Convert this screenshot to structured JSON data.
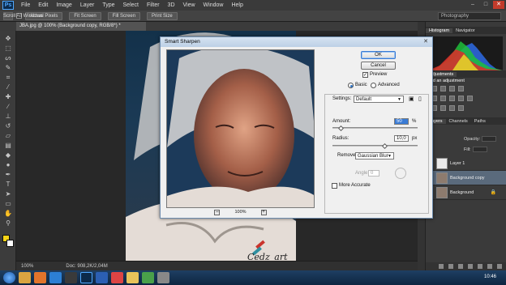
{
  "menubar": {
    "logo": "Ps",
    "items": [
      "File",
      "Edit",
      "Image",
      "Layer",
      "Type",
      "Select",
      "Filter",
      "3D",
      "View",
      "Window",
      "Help"
    ],
    "window_controls": [
      "–",
      "□",
      "✕"
    ]
  },
  "optionsbar": {
    "scroll_all_label": "Scroll All Windows",
    "buttons": [
      "Actual Pixels",
      "Fit Screen",
      "Fill Screen",
      "Print Size"
    ],
    "workspace": "Photography"
  },
  "document": {
    "tab_title": "JBA.jpg @ 100% (Background copy, RGB/8*) *",
    "zoom": "100%",
    "doc_size": "Doc: 908,2K/2,04M"
  },
  "dialog": {
    "title": "Smart Sharpen",
    "close": "✕",
    "ok_label": "OK",
    "cancel_label": "Cancel",
    "preview_label": "Preview",
    "preview_checked": true,
    "mode_basic": "Basic",
    "mode_advanced": "Advanced",
    "mode_selected": "Basic",
    "settings_label": "Settings:",
    "settings_value": "Default",
    "amount_label": "Amount:",
    "amount_value": "50",
    "amount_unit": "%",
    "amount_fraction": 0.1,
    "radius_label": "Radius:",
    "radius_value": "10,0",
    "radius_unit": "px",
    "radius_fraction": 0.62,
    "remove_label": "Remove:",
    "remove_value": "Gaussian Blur",
    "angle_label": "Angle:",
    "angle_value": "0",
    "more_accurate_label": "More Accurate",
    "more_accurate_checked": false,
    "preview_zoom": "100%",
    "zoom_out": "–",
    "zoom_in": "+"
  },
  "panels": {
    "top_tabs": [
      "Histogram",
      "Navigator"
    ],
    "adjust_tabs": [
      "Adjustments"
    ],
    "adjust_caption": "Add an adjustment",
    "layer_tabs": [
      "Layers",
      "Channels",
      "Paths"
    ],
    "opacity_label": "Opacity:",
    "fill_label": "Fill:",
    "layers": [
      {
        "name": "Layer 1",
        "selected": false,
        "locked": false
      },
      {
        "name": "Background copy",
        "selected": true,
        "locked": false
      },
      {
        "name": "Background",
        "selected": false,
        "locked": true
      }
    ]
  },
  "watermark": "Cedz_art",
  "taskbar": {
    "apps": [
      "start-icon",
      "explorer-icon",
      "firefox-icon",
      "ie-icon",
      "media-icon",
      "photoshop-icon",
      "word-icon",
      "chrome-icon",
      "folder-icon",
      "paint-icon",
      "app-icon"
    ],
    "time": "10:46"
  },
  "colors": {
    "foreground": "#f7d417",
    "background": "#ffffff",
    "accent": "#2b6fbf"
  }
}
